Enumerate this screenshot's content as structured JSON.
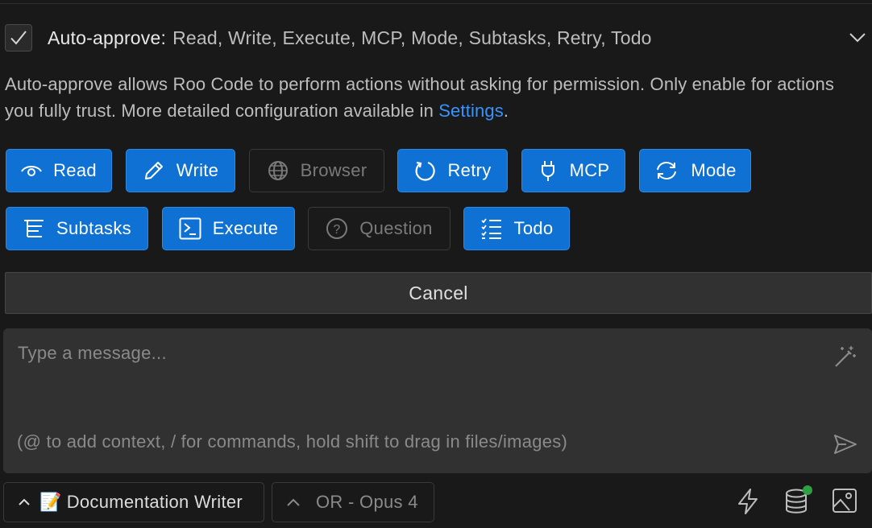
{
  "auto_approve": {
    "checked": true,
    "title": "Auto-approve:",
    "enabled_list": "Read, Write, Execute, MCP, Mode, Subtasks, Retry, Todo",
    "description_before": "Auto-approve allows Roo Code to perform actions without asking for permission. Only enable for actions you fully trust. More detailed configuration available in",
    "settings_link": "Settings",
    "description_after": ".",
    "buttons": [
      {
        "label": "Read",
        "icon": "eye-icon",
        "enabled": true
      },
      {
        "label": "Write",
        "icon": "pencil-icon",
        "enabled": true
      },
      {
        "label": "Browser",
        "icon": "globe-icon",
        "enabled": false
      },
      {
        "label": "Retry",
        "icon": "retry-icon",
        "enabled": true
      },
      {
        "label": "MCP",
        "icon": "plug-icon",
        "enabled": true
      },
      {
        "label": "Mode",
        "icon": "sync-icon",
        "enabled": true
      },
      {
        "label": "Subtasks",
        "icon": "list-tree-icon",
        "enabled": true
      },
      {
        "label": "Execute",
        "icon": "terminal-icon",
        "enabled": true
      },
      {
        "label": "Question",
        "icon": "question-icon",
        "enabled": false
      },
      {
        "label": "Todo",
        "icon": "checklist-icon",
        "enabled": true
      }
    ]
  },
  "cancel_label": "Cancel",
  "chat_input": {
    "placeholder": "Type a message...",
    "hint": "(@ to add context, / for commands, hold shift to drag in files/images)"
  },
  "footer": {
    "mode_emoji": "📝",
    "mode_label": "Documentation Writer",
    "model_label": "OR - Opus 4"
  },
  "colors": {
    "accent": "#0e71d3",
    "link": "#3794ff",
    "status_dot": "#2ea043",
    "background": "#191919",
    "input_bg": "#313131"
  }
}
